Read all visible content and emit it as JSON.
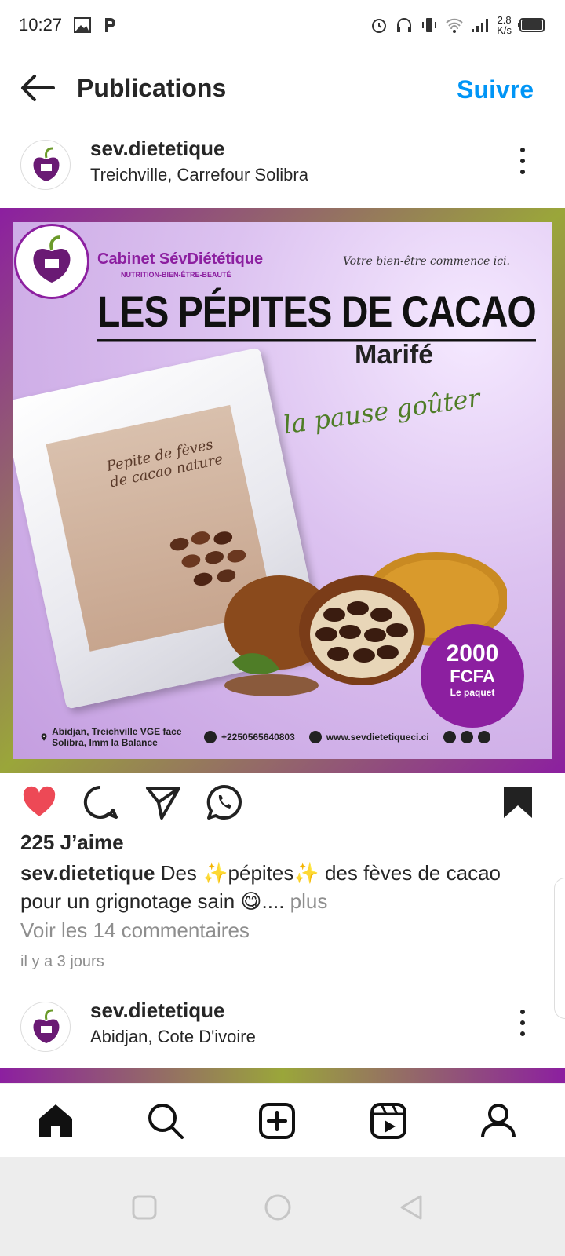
{
  "status_bar": {
    "time": "10:27",
    "net_speed_value": "2.8",
    "net_speed_unit": "K/s"
  },
  "header": {
    "title": "Publications",
    "follow_label": "Suivre"
  },
  "post": {
    "username": "sev.dietetique",
    "location": "Treichville, Carrefour Solibra",
    "poster": {
      "brand": "Cabinet SévDiététique",
      "brand_sub": "NUTRITION-BIEN-ÊTRE-BEAUTÉ",
      "tagline": "Votre bien-être commence ici.",
      "title": "LES PÉPITES DE CACAO",
      "product_brand": "Marifé",
      "script_text": "la pause goûter",
      "bag_text": "Pepite de fèves de cacao nature",
      "price_value": "2000",
      "price_currency": "FCFA",
      "price_unit": "Le paquet",
      "footer_address": "Abidjan, Treichville VGE face Solibra, Imm la Balance",
      "footer_phone": "+2250565640803",
      "footer_web": "www.sevdietetiqueci.ci"
    },
    "likes": "225 J’aime",
    "caption_user": "sev.dietetique",
    "caption_text": " Des ✨pépites✨ des fèves de cacao pour un grignotage sain 😋....",
    "caption_more": " plus",
    "comments_link": "Voir les 14 commentaires",
    "time_ago": "il y a 3 jours",
    "liked": true,
    "saved": true
  },
  "next_post": {
    "username": "sev.dietetique",
    "location": "Abidjan, Cote D'ivoire"
  },
  "colors": {
    "accent": "#0095f6",
    "like": "#ed4956",
    "brand_purple": "#8c1fa0"
  },
  "icons": [
    "back-arrow-icon",
    "more-icon",
    "heart-icon",
    "comment-icon",
    "share-icon",
    "whatsapp-icon",
    "bookmark-icon",
    "home-icon",
    "search-icon",
    "add-icon",
    "reels-icon",
    "profile-icon"
  ]
}
